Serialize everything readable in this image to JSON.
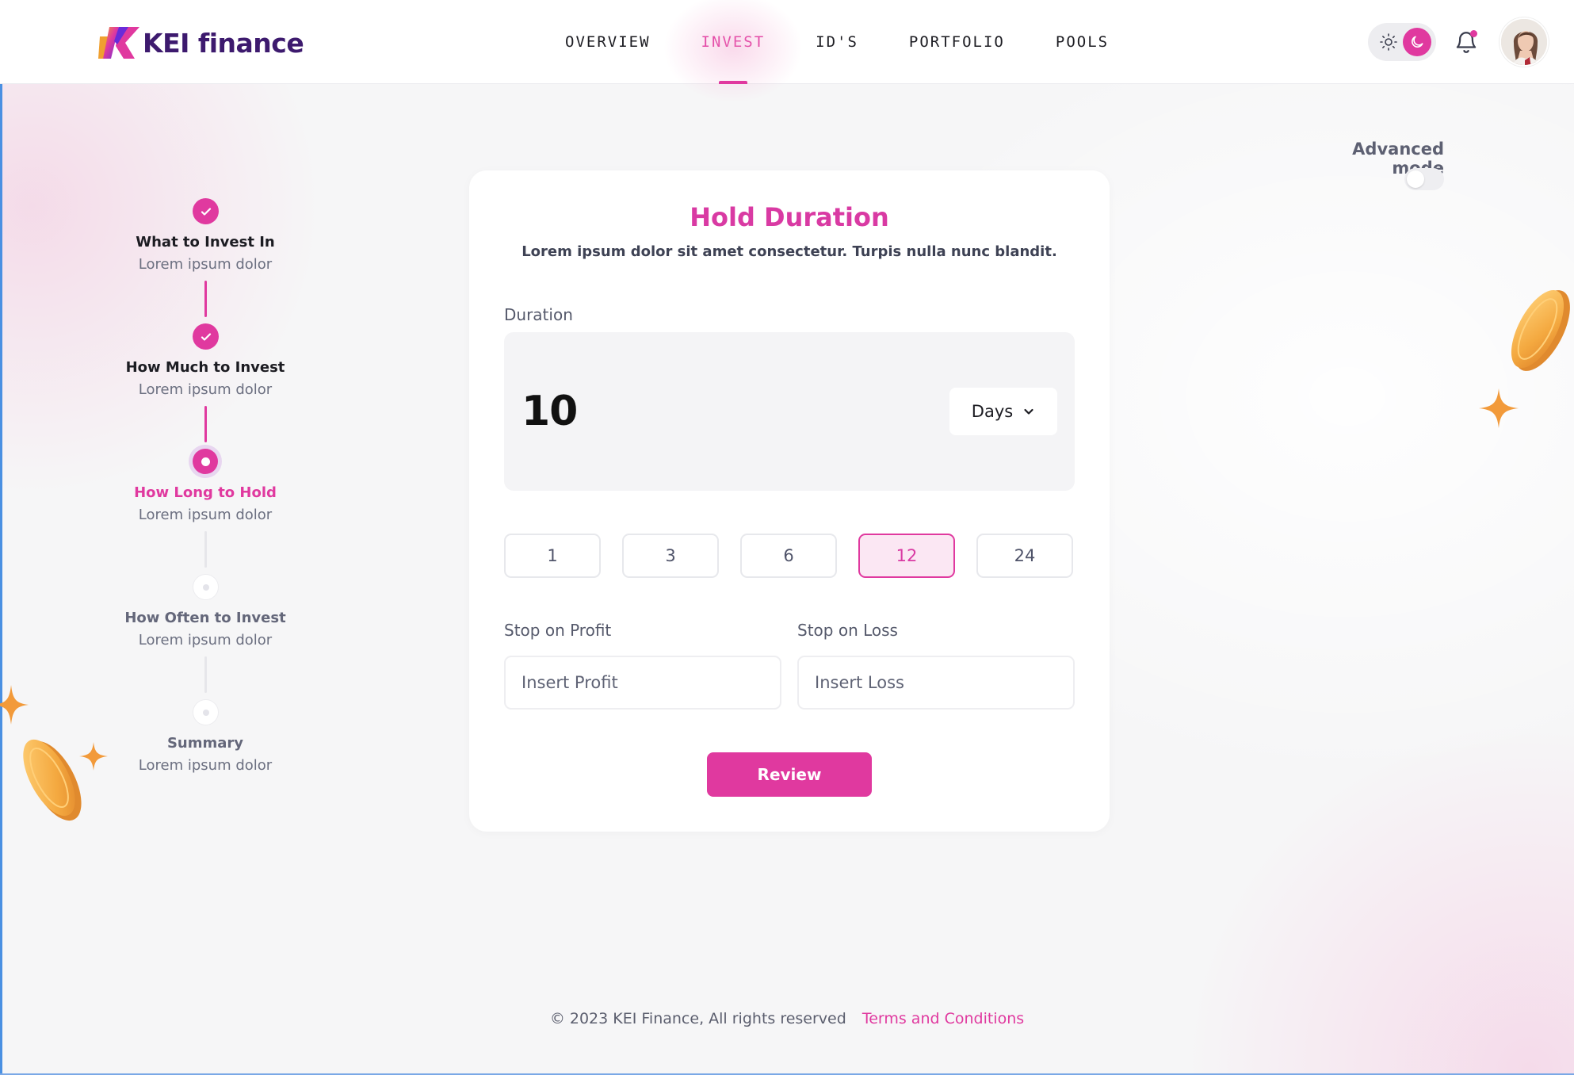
{
  "brand": {
    "name": "KEI finance",
    "accent_color": "#e0399f",
    "dark_color": "#3d1a6e"
  },
  "nav": {
    "items": [
      {
        "label": "OVERVIEW"
      },
      {
        "label": "INVEST",
        "active": true
      },
      {
        "label": "ID'S"
      },
      {
        "label": "PORTFOLIO"
      },
      {
        "label": "POOLS"
      }
    ]
  },
  "header_icons": {
    "theme": [
      "sun-icon",
      "moon-icon"
    ],
    "notifications": "bell-icon",
    "notification_badge": true,
    "avatar": "user-avatar"
  },
  "stepper": {
    "steps": [
      {
        "title": "What to Invest In",
        "subtitle": "Lorem ipsum dolor",
        "state": "done"
      },
      {
        "title": "How Much to Invest",
        "subtitle": "Lorem ipsum dolor",
        "state": "done"
      },
      {
        "title": "How Long to Hold",
        "subtitle": "Lorem ipsum dolor",
        "state": "current"
      },
      {
        "title": "How Often to Invest",
        "subtitle": "Lorem ipsum dolor",
        "state": "todo"
      },
      {
        "title": "Summary",
        "subtitle": "Lorem ipsum dolor",
        "state": "todo"
      }
    ]
  },
  "advanced_mode": {
    "label": "Advanced mode",
    "enabled": false
  },
  "card": {
    "title": "Hold Duration",
    "description": "Lorem ipsum dolor sit amet consectetur. Turpis nulla nunc blandit.",
    "duration_label": "Duration",
    "duration_value": "10",
    "duration_unit": "Days",
    "presets": [
      "1",
      "3",
      "6",
      "12",
      "24"
    ],
    "selected_preset": "12",
    "stop_profit": {
      "label": "Stop on Profit",
      "placeholder": "Insert Profit"
    },
    "stop_loss": {
      "label": "Stop on Loss",
      "placeholder": "Insert Loss"
    },
    "review_label": "Review"
  },
  "footer": {
    "copyright": "© 2023 KEI Finance, All rights reserved",
    "terms": "Terms and Conditions"
  }
}
